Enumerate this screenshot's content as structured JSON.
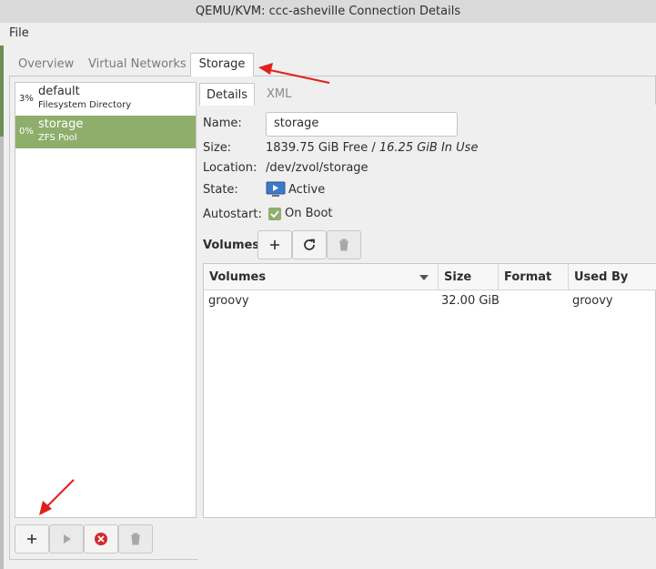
{
  "window": {
    "title": "QEMU/KVM: ccc-asheville Connection Details"
  },
  "menu": {
    "file": "File"
  },
  "tabs": {
    "overview": "Overview",
    "virtual_networks": "Virtual Networks",
    "storage": "Storage"
  },
  "pools": [
    {
      "percent": "3%",
      "name": "default",
      "type": "Filesystem Directory"
    },
    {
      "percent": "0%",
      "name": "storage",
      "type": "ZFS Pool"
    }
  ],
  "detail_tabs": {
    "details": "Details",
    "xml": "XML"
  },
  "details": {
    "name_label": "Name:",
    "name_value": "storage",
    "size_label": "Size:",
    "size_free": "1839.75 GiB Free",
    "size_sep": " / ",
    "size_used": "16.25 GiB In Use",
    "location_label": "Location:",
    "location_value": "/dev/zvol/storage",
    "state_label": "State:",
    "state_value": "Active",
    "autostart_label": "Autostart:",
    "autostart_value": "On Boot",
    "autostart_checked": true
  },
  "volumes_section": {
    "label": "Volumes"
  },
  "volume_table": {
    "headers": {
      "volumes": "Volumes",
      "size": "Size",
      "format": "Format",
      "used_by": "Used By"
    },
    "rows": [
      {
        "name": "groovy",
        "size": "32.00 GiB",
        "format": "",
        "used_by": "groovy"
      }
    ]
  },
  "annotations": {
    "arrow_color": "#e0201c"
  },
  "colors": {
    "selection": "#8fae6c",
    "accent_green": "#6f8e55"
  }
}
